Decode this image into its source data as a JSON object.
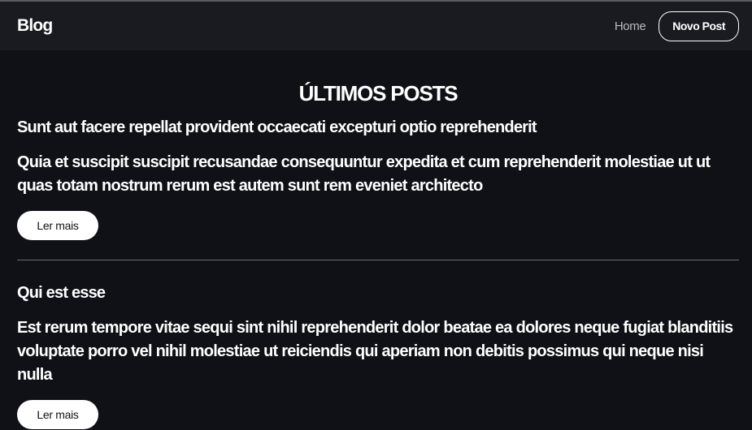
{
  "header": {
    "brand": "Blog",
    "nav": {
      "home": "Home",
      "new_post": "Novo Post"
    }
  },
  "main": {
    "title": "ÚLTIMOS POSTS",
    "posts": [
      {
        "title": "Sunt aut facere repellat provident occaecati excepturi optio reprehenderit",
        "body": "Quia et suscipit suscipit recusandae consequuntur expedita et cum reprehenderit molestiae ut ut quas totam nostrum rerum est autem sunt rem eveniet architecto",
        "button": "Ler mais"
      },
      {
        "title": "Qui est esse",
        "body": "Est rerum tempore vitae sequi sint nihil reprehenderit dolor beatae ea dolores neque fugiat blanditiis voluptate porro vel nihil molestiae ut reiciendis qui aperiam non debitis possimus qui neque nisi nulla",
        "button": "Ler mais"
      }
    ]
  }
}
